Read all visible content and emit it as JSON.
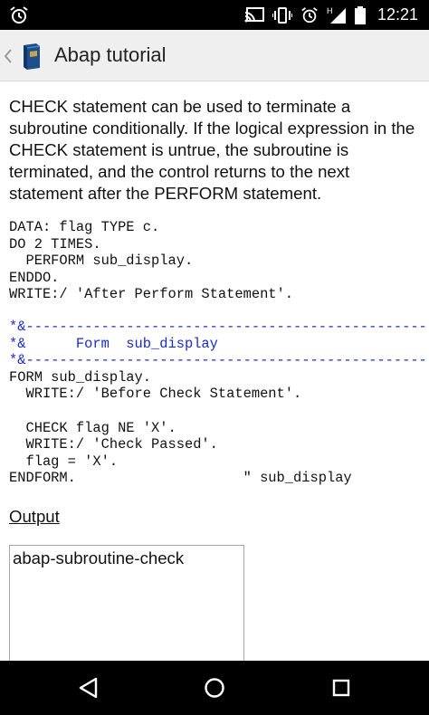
{
  "status_bar": {
    "time": "12:21",
    "left_icon": "alarm-icon",
    "icons": [
      "cast-icon",
      "vibrate-icon",
      "alarm-icon",
      "signal-h-icon",
      "battery-icon"
    ],
    "network_label": "H"
  },
  "app_bar": {
    "title": "Abap tutorial",
    "back_icon": "chevron-left-icon",
    "app_icon": "book-icon"
  },
  "content": {
    "intro": "CHECK statement can be used to terminate a subroutine conditionally. If the logical expression in the CHECK statement is untrue, the subroutine is terminated, and the control returns to the next statement after the PERFORM statement.",
    "code_block_1": [
      "DATA: flag TYPE c.",
      "DO 2 TIMES.",
      "  PERFORM sub_display.",
      "ENDDO.",
      "WRITE:/ 'After Perform Statement'."
    ],
    "comment_lines": [
      "*&------------------------------------------------------------",
      "*&      Form  sub_display",
      "*&------------------------------------------------------------"
    ],
    "code_block_2": [
      "FORM sub_display.",
      "  WRITE:/ 'Before Check Statement'.",
      "",
      "  CHECK flag NE 'X'.",
      "  WRITE:/ 'Check Passed'.",
      "  flag = 'X'.",
      "ENDFORM.                    \" sub_display"
    ],
    "output_label": "Output",
    "output_text": "abap-subroutine-check"
  },
  "nav_bar": {
    "icons": [
      "back-triangle-icon",
      "home-circle-icon",
      "recents-square-icon"
    ]
  },
  "colors": {
    "status_bar_bg": "#000000",
    "app_bar_bg": "#efefef",
    "comment": "#1a2bc7",
    "text": "#111111"
  }
}
